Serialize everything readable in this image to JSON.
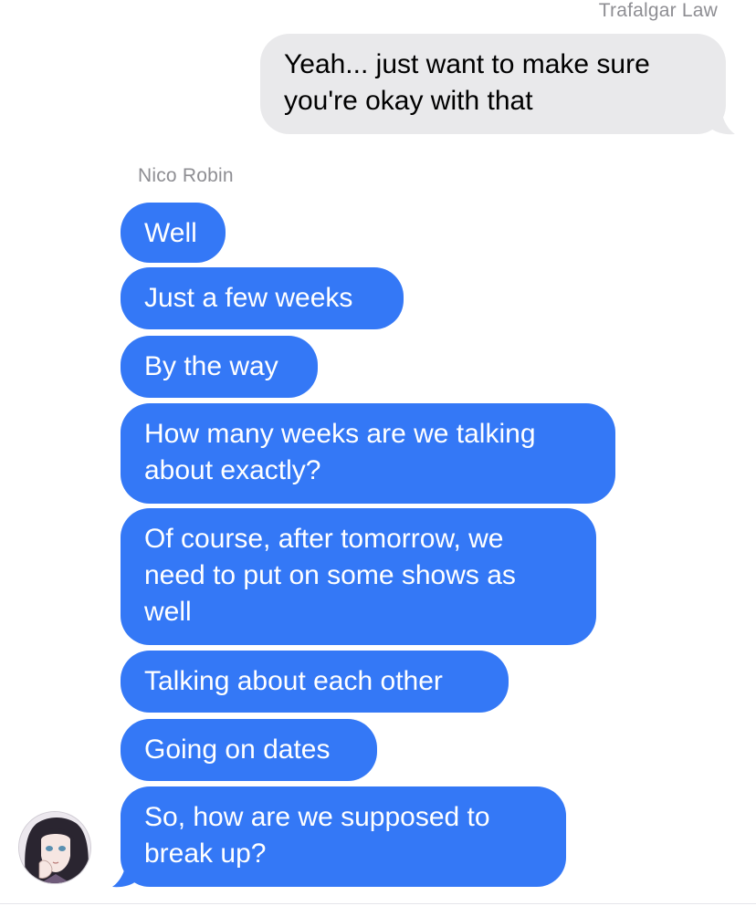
{
  "conversation": {
    "outgoing_sender": "Trafalgar Law",
    "incoming_sender": "Nico Robin",
    "outgoing_messages": [
      {
        "lines": [
          "Yeah... just want to make sure",
          "you're okay with that"
        ]
      }
    ],
    "incoming_messages": [
      {
        "lines": [
          "Well"
        ]
      },
      {
        "lines": [
          "Just a few weeks"
        ]
      },
      {
        "lines": [
          "By the way"
        ]
      },
      {
        "lines": [
          "How many weeks are we talking",
          "about exactly?"
        ]
      },
      {
        "lines": [
          "Of course, after tomorrow, we",
          "need to put on some shows as",
          "well"
        ]
      },
      {
        "lines": [
          "Talking about each other"
        ]
      },
      {
        "lines": [
          "Going on dates"
        ]
      },
      {
        "lines": [
          "So, how are we supposed to",
          "break up?"
        ]
      }
    ]
  },
  "colors": {
    "incoming_bubble": "#3478f6",
    "outgoing_bubble": "#e9e9eb",
    "sender_name": "#8e8e93"
  },
  "icons": {
    "avatar": "anime-character-avatar-icon"
  }
}
